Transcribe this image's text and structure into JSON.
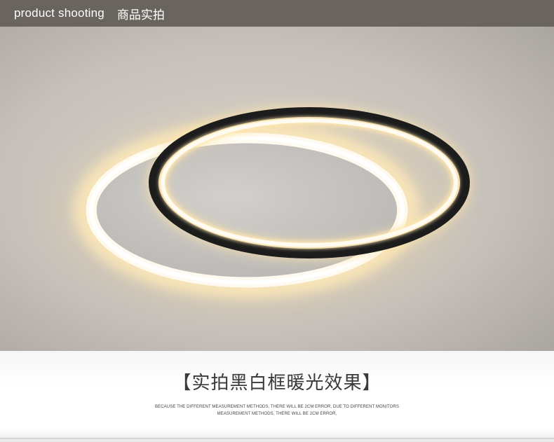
{
  "header": {
    "title_en": "product shooting",
    "title_cn": "商品实拍"
  },
  "photo": {
    "subject": "ring-ceiling-lamp",
    "colors": {
      "ceiling": "#c9c4bd",
      "glow": "#fff3cc",
      "ring_black": "#1c1c1c",
      "disc_gray": "#c6c4c0"
    }
  },
  "caption": {
    "title": "【实拍黑白框暖光效果】",
    "note_line1": "BECAUSE THE DIFFERENT MEASUREMENT METHODS, THERE WILL BE 2CM ERROR, DUE TO DIFFERENT MONITORS",
    "note_line2": "MEASUREMENT METHODS, THERE WILL BE 2CM ERROR,"
  }
}
